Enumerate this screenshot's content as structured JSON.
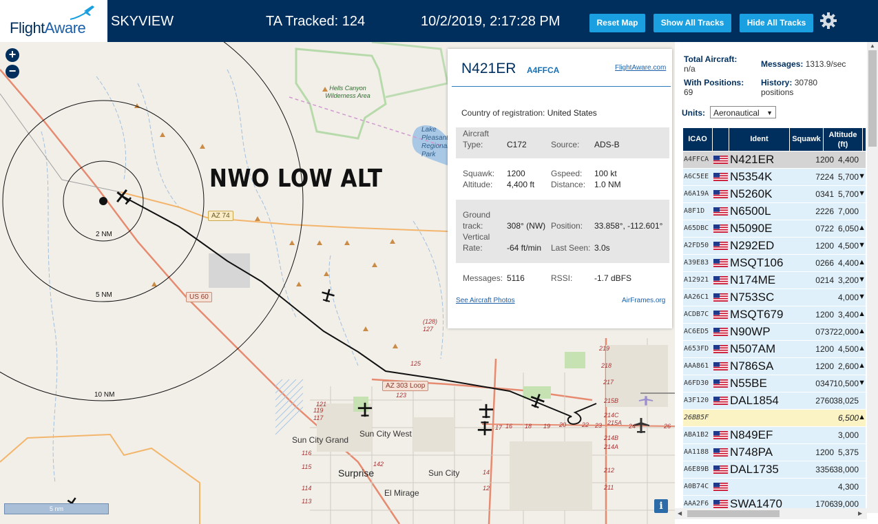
{
  "header": {
    "logo": {
      "flight": "Flight",
      "aware": "Aware"
    },
    "app_title": "SKYVIEW",
    "tracked": "TA Tracked: 124",
    "datetime": "10/2/2019, 2:17:28 PM",
    "buttons": {
      "reset": "Reset Map",
      "show": "Show All Tracks",
      "hide": "Hide All Tracks"
    }
  },
  "map": {
    "zoom_in": "+",
    "zoom_out": "−",
    "overlay_label": "NWO LOW ALT",
    "rings": [
      "2 NM",
      "5 NM",
      "10 NM"
    ],
    "roads": [
      "AZ 74",
      "US 60",
      "AZ 303 Loop",
      "(128)"
    ],
    "places": [
      "Sun City Grand",
      "Sun City West",
      "Surprise",
      "Sun City",
      "El Mirage"
    ],
    "wilderness": "Hells Canyon Wilderness Area",
    "lake": "Lake Pleasant Regional Park",
    "exits": [
      "127",
      "125",
      "123",
      "121",
      "119",
      "117",
      "116",
      "115",
      "114",
      "113",
      "142",
      "14",
      "12",
      "16",
      "17",
      "18",
      "19",
      "20",
      "22",
      "23",
      "24",
      "26",
      "219",
      "218",
      "217",
      "215B",
      "214C",
      "215A",
      "214B",
      "214A",
      "212",
      "211"
    ],
    "scale": "5 nm",
    "info": "i"
  },
  "popup": {
    "ident": "N421ER",
    "icao": "A4FFCA",
    "fa_link": "FlightAware.com",
    "country_label": "Country of registration:",
    "country": "United States",
    "aircraft_type_label1": "Aircraft",
    "aircraft_type_label2": "Type:",
    "aircraft_type": "C172",
    "source_label": "Source:",
    "source": "ADS-B",
    "squawk_label": "Squawk:",
    "squawk": "1200",
    "gspeed_label": "Gspeed:",
    "gspeed": "100 kt",
    "altitude_label": "Altitude:",
    "altitude": "4,400 ft",
    "distance_label": "Distance:",
    "distance": "1.0 NM",
    "track_label1": "Ground",
    "track_label2": "track:",
    "track": "308° (NW)",
    "position_label": "Position:",
    "position": "33.858°, -112.601°",
    "vrate_label1": "Vertical",
    "vrate_label2": "Rate:",
    "vrate": "-64 ft/min",
    "lastseen_label": "Last Seen:",
    "lastseen": "3.0s",
    "messages_label": "Messages:",
    "messages": "5116",
    "rssi_label": "RSSI:",
    "rssi": "-1.7 dBFS",
    "photos_link": "See Aircraft Photos",
    "airframes": "AirFrames.org"
  },
  "sidebar": {
    "total_label": "Total Aircraft:",
    "total": "n/a",
    "messages_label": "Messages:",
    "messages": "1313.9/sec",
    "positions_label": "With Positions:",
    "positions": "69",
    "history_label": "History:",
    "history_value": "30780",
    "history_unit": "positions",
    "units_label": "Units:",
    "units": "Aeronautical",
    "columns": {
      "icao": "ICAO",
      "ident": "Ident",
      "squawk": "Squawk",
      "alt1": "Altitude",
      "alt2": "(ft)"
    },
    "rows": [
      {
        "icao": "A4FFCA",
        "ident": "N421ER",
        "squawk": "1200",
        "alt": "4,400",
        "dir": "",
        "flag": true,
        "style": "sel"
      },
      {
        "icao": "A6C5EE",
        "ident": "N5354K",
        "squawk": "7224",
        "alt": "5,700",
        "dir": "▼",
        "flag": true,
        "style": ""
      },
      {
        "icao": "A6A19A",
        "ident": "N5260K",
        "squawk": "0341",
        "alt": "5,700",
        "dir": "▼",
        "flag": true,
        "style": ""
      },
      {
        "icao": "A8F1D",
        "ident": "N6500L",
        "squawk": "2226",
        "alt": "7,000",
        "dir": "",
        "flag": true,
        "style": ""
      },
      {
        "icao": "A65DBC",
        "ident": "N5090E",
        "squawk": "0722",
        "alt": "6,050",
        "dir": "▲",
        "flag": true,
        "style": ""
      },
      {
        "icao": "A2FD50",
        "ident": "N292ED",
        "squawk": "1200",
        "alt": "4,500",
        "dir": "▼",
        "flag": true,
        "style": ""
      },
      {
        "icao": "A39E83",
        "ident": "MSQT106",
        "squawk": "0266",
        "alt": "4,400",
        "dir": "▲",
        "flag": true,
        "style": ""
      },
      {
        "icao": "A12921",
        "ident": "N174ME",
        "squawk": "0214",
        "alt": "3,200",
        "dir": "▼",
        "flag": true,
        "style": ""
      },
      {
        "icao": "AA26C1",
        "ident": "N753SC",
        "squawk": "",
        "alt": "4,000",
        "dir": "▼",
        "flag": true,
        "style": ""
      },
      {
        "icao": "ACDB7C",
        "ident": "MSQT679",
        "squawk": "1200",
        "alt": "3,400",
        "dir": "▲",
        "flag": true,
        "style": ""
      },
      {
        "icao": "AC6ED5",
        "ident": "N90WP",
        "squawk": "0737",
        "alt": "22,000",
        "dir": "▲",
        "flag": true,
        "style": ""
      },
      {
        "icao": "A653FD",
        "ident": "N507AM",
        "squawk": "1200",
        "alt": "4,500",
        "dir": "▲",
        "flag": true,
        "style": ""
      },
      {
        "icao": "AAA861",
        "ident": "N786SA",
        "squawk": "1200",
        "alt": "2,600",
        "dir": "▲",
        "flag": true,
        "style": ""
      },
      {
        "icao": "A6FD30",
        "ident": "N55BE",
        "squawk": "0347",
        "alt": "10,500",
        "dir": "▼",
        "flag": true,
        "style": ""
      },
      {
        "icao": "A3F120",
        "ident": "DAL1854",
        "squawk": "2760",
        "alt": "38,025",
        "dir": "",
        "flag": true,
        "style": ""
      },
      {
        "icao": "26BB5F",
        "ident": "",
        "squawk": "",
        "alt": "6,500",
        "dir": "▲",
        "flag": false,
        "style": "yel"
      },
      {
        "icao": "ABA1B2",
        "ident": "N849EF",
        "squawk": "",
        "alt": "3,000",
        "dir": "",
        "flag": true,
        "style": ""
      },
      {
        "icao": "AA1188",
        "ident": "N748PA",
        "squawk": "1200",
        "alt": "5,375",
        "dir": "",
        "flag": true,
        "style": ""
      },
      {
        "icao": "A6E89B",
        "ident": "DAL1735",
        "squawk": "3356",
        "alt": "38,000",
        "dir": "",
        "flag": true,
        "style": ""
      },
      {
        "icao": "A0B74C",
        "ident": "",
        "squawk": "",
        "alt": "4,300",
        "dir": "",
        "flag": true,
        "style": ""
      },
      {
        "icao": "AAA2F6",
        "ident": "SWA1470",
        "squawk": "1706",
        "alt": "39,000",
        "dir": "",
        "flag": true,
        "style": ""
      }
    ]
  },
  "colors": {
    "header_bg": "#002f5d",
    "button_bg": "#1aa0e0",
    "row_bg": "#e0f0fa",
    "row_selected": "#d4d4d4",
    "row_highlight": "#fcf3c5"
  }
}
